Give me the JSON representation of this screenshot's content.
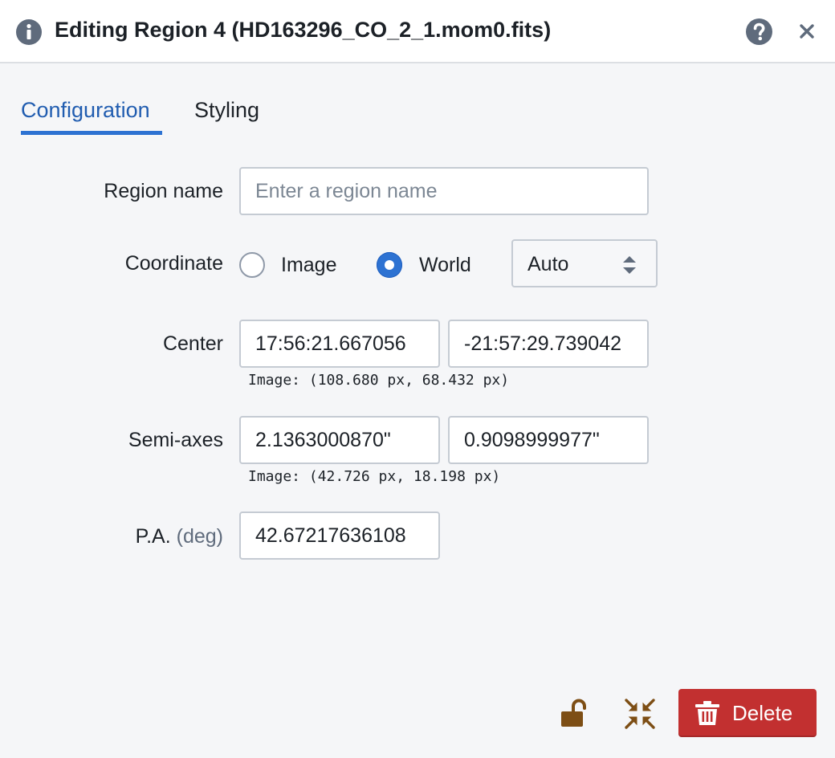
{
  "dialog": {
    "title": "Editing Region 4 (HD163296_CO_2_1.mom0.fits)",
    "icons": {
      "info": "info-icon",
      "help": "help-icon",
      "close": "close-icon"
    }
  },
  "tabs": [
    {
      "label": "Configuration",
      "active": true
    },
    {
      "label": "Styling",
      "active": false
    }
  ],
  "form": {
    "region_name": {
      "label": "Region name",
      "value": "",
      "placeholder": "Enter a region name"
    },
    "coordinate": {
      "label": "Coordinate",
      "options": [
        {
          "label": "Image",
          "selected": false
        },
        {
          "label": "World",
          "selected": true
        }
      ],
      "format": "Auto"
    },
    "center": {
      "label": "Center",
      "x": "17:56:21.667056",
      "y": "-21:57:29.739042",
      "hint": "Image: (108.680 px, 68.432 px)"
    },
    "semi_axes": {
      "label": "Semi-axes",
      "a": "2.1363000870\"",
      "b": "0.9098999977\"",
      "hint": "Image: (42.726 px, 18.198 px)"
    },
    "pa": {
      "label": "P.A.",
      "unit": "(deg)",
      "value": "42.67217636108"
    }
  },
  "footer": {
    "delete_label": "Delete",
    "icons": {
      "lock": "unlock-icon",
      "focus": "focus-center-icon",
      "delete": "trash-icon"
    }
  },
  "colors": {
    "accent": "#2d72d2",
    "danger": "#c23030",
    "icon_brown": "#7d4e15",
    "background": "#f5f6f8"
  }
}
